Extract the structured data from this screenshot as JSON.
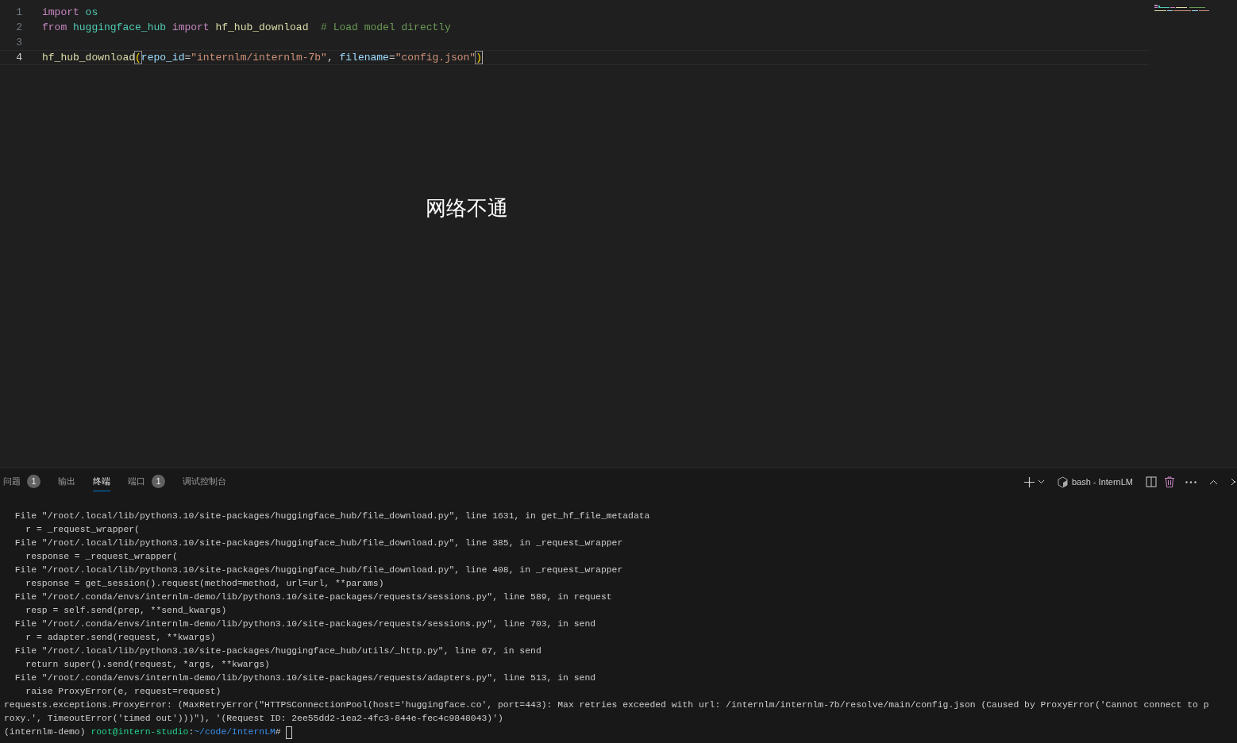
{
  "editor": {
    "lines": [
      {
        "number": "1",
        "current": false,
        "tokens": [
          {
            "text": "import",
            "kind": "keyword",
            "space_after": true
          },
          {
            "text": "os",
            "kind": "module"
          }
        ]
      },
      {
        "number": "2",
        "current": false,
        "tokens": [
          {
            "text": "from",
            "kind": "keyword",
            "space_after": true
          },
          {
            "text": "huggingface_hub",
            "kind": "module",
            "space_after": true
          },
          {
            "text": "import",
            "kind": "keyword",
            "space_after": true
          },
          {
            "text": "hf_hub_download",
            "kind": "func",
            "space_after": true
          },
          {
            "text": "# Load model directly",
            "kind": "comment"
          }
        ]
      },
      {
        "number": "3",
        "current": false
      },
      {
        "number": "4",
        "current": true,
        "tokens": [
          {
            "text": "hf_hub_download",
            "kind": "func"
          },
          {
            "text": "(",
            "kind": "bracket"
          },
          {
            "text": "repo_id",
            "kind": "param"
          },
          {
            "text": "=",
            "kind": "plain"
          },
          {
            "text": "\"internlm/internlm-7b\"",
            "kind": "string"
          },
          {
            "text": ",",
            "kind": "plain",
            "space_after": true
          },
          {
            "text": "filename",
            "kind": "param"
          },
          {
            "text": "=",
            "kind": "plain"
          },
          {
            "text": "\"config.json\"",
            "kind": "string"
          },
          {
            "text": ")",
            "kind": "bracket"
          }
        ]
      }
    ],
    "overlay_note": "网络不通"
  },
  "panel": {
    "tabs": [
      {
        "label": "问题",
        "badge": "1",
        "selected": false
      },
      {
        "label": "输出",
        "selected": false
      },
      {
        "label": "终端",
        "selected": true
      },
      {
        "label": "端口",
        "badge": "1",
        "selected": false
      },
      {
        "label": "调试控制台",
        "selected": false
      }
    ],
    "terminal_name": "bash - InternLM",
    "terminal_lines": [
      "  File \"/root/.local/lib/python3.10/site-packages/huggingface_hub/file_download.py\", line 1631, in get_hf_file_metadata",
      "    r = _request_wrapper(",
      "  File \"/root/.local/lib/python3.10/site-packages/huggingface_hub/file_download.py\", line 385, in _request_wrapper",
      "    response = _request_wrapper(",
      "  File \"/root/.local/lib/python3.10/site-packages/huggingface_hub/file_download.py\", line 408, in _request_wrapper",
      "    response = get_session().request(method=method, url=url, **params)",
      "  File \"/root/.conda/envs/internlm-demo/lib/python3.10/site-packages/requests/sessions.py\", line 589, in request",
      "    resp = self.send(prep, **send_kwargs)",
      "  File \"/root/.conda/envs/internlm-demo/lib/python3.10/site-packages/requests/sessions.py\", line 703, in send",
      "    r = adapter.send(request, **kwargs)",
      "  File \"/root/.local/lib/python3.10/site-packages/huggingface_hub/utils/_http.py\", line 67, in send",
      "    return super().send(request, *args, **kwargs)",
      "  File \"/root/.conda/envs/internlm-demo/lib/python3.10/site-packages/requests/adapters.py\", line 513, in send",
      "    raise ProxyError(e, request=request)",
      "requests.exceptions.ProxyError: (MaxRetryError(\"HTTPSConnectionPool(host='huggingface.co', port=443): Max retries exceeded with url: /internlm/internlm-7b/resolve/main/config.json (Caused by ProxyError('Cannot connect to p",
      "roxy.', TimeoutError('timed out')))\"), '(Request ID: 2ee55dd2-1ea2-4fc3-844e-fec4c9848043)')"
    ],
    "prompt": {
      "env": "(internlm-demo) ",
      "user": "root@intern-studio",
      "separator": ":",
      "path": "~/code/InternLM",
      "symbol": "# "
    }
  }
}
